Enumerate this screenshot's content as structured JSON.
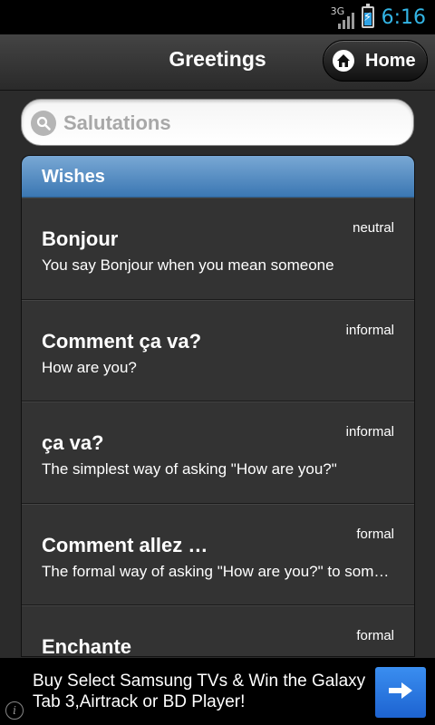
{
  "status_bar": {
    "network_type": "3G",
    "battery_level": 0.7,
    "time": "6:16"
  },
  "header": {
    "title": "Greetings",
    "home_label": "Home",
    "home_icon": "home-icon"
  },
  "search": {
    "placeholder": "Salutations",
    "value": "",
    "icon": "search-icon"
  },
  "list": {
    "divider": "Wishes",
    "items": [
      {
        "title": "Bonjour",
        "description": "You say Bonjour when you mean someone",
        "tag": "neutral"
      },
      {
        "title": "Comment ça va?",
        "description": "How are you?",
        "tag": "informal"
      },
      {
        "title": "ça va?",
        "description": "The simplest way of asking \"How are you?\"",
        "tag": "informal"
      },
      {
        "title": "Comment allez …",
        "description": "The formal way of asking \"How are you?\" to someone",
        "tag": "formal"
      },
      {
        "title": "Enchante",
        "description": "",
        "tag": "formal"
      }
    ]
  },
  "ad": {
    "text": "Buy Select Samsung TVs & Win the Galaxy Tab 3,Airtrack or BD Player!",
    "button_icon": "arrow-right-icon",
    "info_icon": "info-icon",
    "accent": "#2a78e4"
  }
}
